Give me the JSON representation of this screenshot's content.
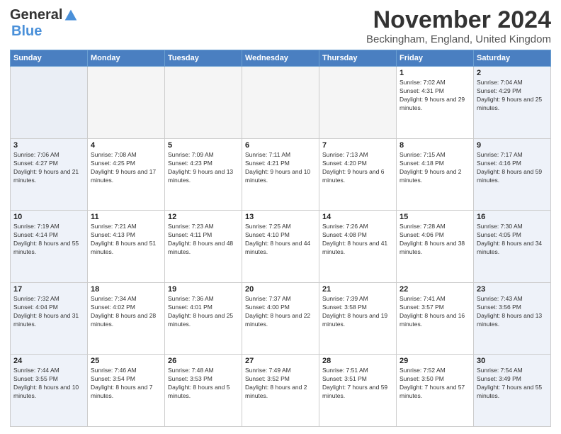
{
  "logo": {
    "general": "General",
    "blue": "Blue"
  },
  "header": {
    "month": "November 2024",
    "location": "Beckingham, England, United Kingdom"
  },
  "days_of_week": [
    "Sunday",
    "Monday",
    "Tuesday",
    "Wednesday",
    "Thursday",
    "Friday",
    "Saturday"
  ],
  "weeks": [
    [
      {
        "day": "",
        "info": ""
      },
      {
        "day": "",
        "info": ""
      },
      {
        "day": "",
        "info": ""
      },
      {
        "day": "",
        "info": ""
      },
      {
        "day": "",
        "info": ""
      },
      {
        "day": "1",
        "info": "Sunrise: 7:02 AM\nSunset: 4:31 PM\nDaylight: 9 hours and 29 minutes."
      },
      {
        "day": "2",
        "info": "Sunrise: 7:04 AM\nSunset: 4:29 PM\nDaylight: 9 hours and 25 minutes."
      }
    ],
    [
      {
        "day": "3",
        "info": "Sunrise: 7:06 AM\nSunset: 4:27 PM\nDaylight: 9 hours and 21 minutes."
      },
      {
        "day": "4",
        "info": "Sunrise: 7:08 AM\nSunset: 4:25 PM\nDaylight: 9 hours and 17 minutes."
      },
      {
        "day": "5",
        "info": "Sunrise: 7:09 AM\nSunset: 4:23 PM\nDaylight: 9 hours and 13 minutes."
      },
      {
        "day": "6",
        "info": "Sunrise: 7:11 AM\nSunset: 4:21 PM\nDaylight: 9 hours and 10 minutes."
      },
      {
        "day": "7",
        "info": "Sunrise: 7:13 AM\nSunset: 4:20 PM\nDaylight: 9 hours and 6 minutes."
      },
      {
        "day": "8",
        "info": "Sunrise: 7:15 AM\nSunset: 4:18 PM\nDaylight: 9 hours and 2 minutes."
      },
      {
        "day": "9",
        "info": "Sunrise: 7:17 AM\nSunset: 4:16 PM\nDaylight: 8 hours and 59 minutes."
      }
    ],
    [
      {
        "day": "10",
        "info": "Sunrise: 7:19 AM\nSunset: 4:14 PM\nDaylight: 8 hours and 55 minutes."
      },
      {
        "day": "11",
        "info": "Sunrise: 7:21 AM\nSunset: 4:13 PM\nDaylight: 8 hours and 51 minutes."
      },
      {
        "day": "12",
        "info": "Sunrise: 7:23 AM\nSunset: 4:11 PM\nDaylight: 8 hours and 48 minutes."
      },
      {
        "day": "13",
        "info": "Sunrise: 7:25 AM\nSunset: 4:10 PM\nDaylight: 8 hours and 44 minutes."
      },
      {
        "day": "14",
        "info": "Sunrise: 7:26 AM\nSunset: 4:08 PM\nDaylight: 8 hours and 41 minutes."
      },
      {
        "day": "15",
        "info": "Sunrise: 7:28 AM\nSunset: 4:06 PM\nDaylight: 8 hours and 38 minutes."
      },
      {
        "day": "16",
        "info": "Sunrise: 7:30 AM\nSunset: 4:05 PM\nDaylight: 8 hours and 34 minutes."
      }
    ],
    [
      {
        "day": "17",
        "info": "Sunrise: 7:32 AM\nSunset: 4:04 PM\nDaylight: 8 hours and 31 minutes."
      },
      {
        "day": "18",
        "info": "Sunrise: 7:34 AM\nSunset: 4:02 PM\nDaylight: 8 hours and 28 minutes."
      },
      {
        "day": "19",
        "info": "Sunrise: 7:36 AM\nSunset: 4:01 PM\nDaylight: 8 hours and 25 minutes."
      },
      {
        "day": "20",
        "info": "Sunrise: 7:37 AM\nSunset: 4:00 PM\nDaylight: 8 hours and 22 minutes."
      },
      {
        "day": "21",
        "info": "Sunrise: 7:39 AM\nSunset: 3:58 PM\nDaylight: 8 hours and 19 minutes."
      },
      {
        "day": "22",
        "info": "Sunrise: 7:41 AM\nSunset: 3:57 PM\nDaylight: 8 hours and 16 minutes."
      },
      {
        "day": "23",
        "info": "Sunrise: 7:43 AM\nSunset: 3:56 PM\nDaylight: 8 hours and 13 minutes."
      }
    ],
    [
      {
        "day": "24",
        "info": "Sunrise: 7:44 AM\nSunset: 3:55 PM\nDaylight: 8 hours and 10 minutes."
      },
      {
        "day": "25",
        "info": "Sunrise: 7:46 AM\nSunset: 3:54 PM\nDaylight: 8 hours and 7 minutes."
      },
      {
        "day": "26",
        "info": "Sunrise: 7:48 AM\nSunset: 3:53 PM\nDaylight: 8 hours and 5 minutes."
      },
      {
        "day": "27",
        "info": "Sunrise: 7:49 AM\nSunset: 3:52 PM\nDaylight: 8 hours and 2 minutes."
      },
      {
        "day": "28",
        "info": "Sunrise: 7:51 AM\nSunset: 3:51 PM\nDaylight: 7 hours and 59 minutes."
      },
      {
        "day": "29",
        "info": "Sunrise: 7:52 AM\nSunset: 3:50 PM\nDaylight: 7 hours and 57 minutes."
      },
      {
        "day": "30",
        "info": "Sunrise: 7:54 AM\nSunset: 3:49 PM\nDaylight: 7 hours and 55 minutes."
      }
    ]
  ]
}
